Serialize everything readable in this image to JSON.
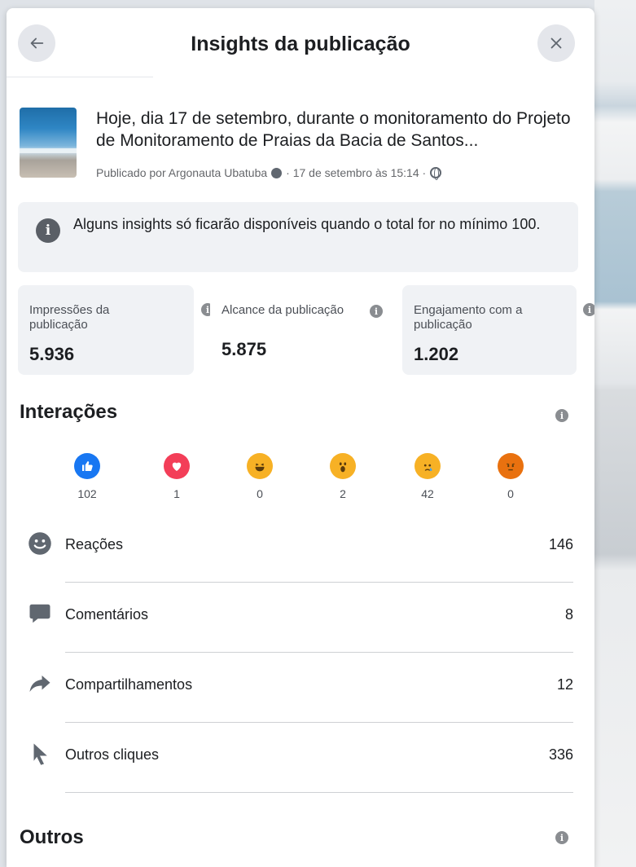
{
  "header": {
    "title": "Insights da publicação"
  },
  "post": {
    "text": "Hoje, dia 17 de setembro, durante o monitoramento do Projeto de Monitoramento de Praias da Bacia de Santos...",
    "author_prefix": "Publicado por Argonauta Ubatuba",
    "date": "· 17 de setembro às 15:14 ·"
  },
  "notice": {
    "text": "Alguns insights só ficarão disponíveis quando o total for no mínimo 100."
  },
  "metrics": [
    {
      "label": "Impressões da publicação",
      "value": "5.936"
    },
    {
      "label": "Alcance da publicação",
      "value": "5.875"
    },
    {
      "label": "Engajamento com a publicação",
      "value": "1.202"
    }
  ],
  "interactions": {
    "title": "Interações",
    "reactions": [
      {
        "name": "like",
        "count": "102",
        "color": "#1877f2"
      },
      {
        "name": "love",
        "count": "1",
        "color": "#f33e58"
      },
      {
        "name": "haha",
        "count": "0",
        "color": "#f7b125"
      },
      {
        "name": "wow",
        "count": "2",
        "color": "#f7b125"
      },
      {
        "name": "sad",
        "count": "42",
        "color": "#f7b125"
      },
      {
        "name": "angry",
        "count": "0",
        "color": "#e9710f"
      }
    ],
    "rows": [
      {
        "label": "Reações",
        "value": "146",
        "icon": "smiley-icon"
      },
      {
        "label": "Comentários",
        "value": "8",
        "icon": "comment-icon"
      },
      {
        "label": "Compartilhamentos",
        "value": "12",
        "icon": "share-icon"
      },
      {
        "label": "Outros cliques",
        "value": "336",
        "icon": "cursor-icon"
      }
    ]
  },
  "others": {
    "title": "Outros"
  }
}
